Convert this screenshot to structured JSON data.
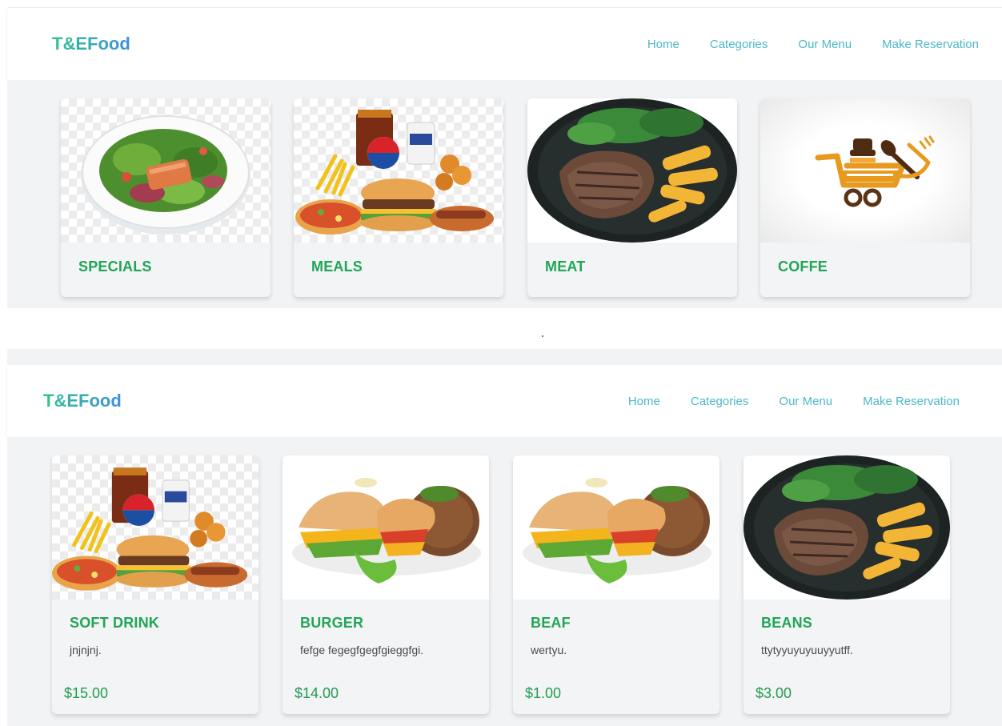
{
  "screenshots": [
    {
      "brand": "T&EFood",
      "nav": [
        "Home",
        "Categories",
        "Our Menu",
        "Make Reservation"
      ],
      "cards": [
        {
          "title": "SPECIALS",
          "image": "salmon-salad-icon"
        },
        {
          "title": "MEALS",
          "image": "fastfood-combo-icon"
        },
        {
          "title": "MEAT",
          "image": "steak-plate-icon"
        },
        {
          "title": "COFFE",
          "image": "food-cart-logo-icon"
        }
      ]
    },
    {
      "brand": "T&EFood",
      "nav": [
        "Home",
        "Categories",
        "Our Menu",
        "Make Reservation"
      ],
      "cards": [
        {
          "title": "SOFT DRINK",
          "description": "jnjnjnj.",
          "price": "$15.00",
          "image": "fastfood-combo-icon"
        },
        {
          "title": "BURGER",
          "description": "fefge fegegfgegfgieggfgi.",
          "price": "$14.00",
          "image": "sandwich-plate-icon"
        },
        {
          "title": "BEAF",
          "description": "wertyu.",
          "price": "$1.00",
          "image": "sandwich-plate-icon"
        },
        {
          "title": "BEANS",
          "description": "ttytyyuyuyuuyyutff.",
          "price": "$3.00",
          "image": "steak-plate-icon"
        }
      ]
    }
  ],
  "colors": {
    "brand_gradient_start": "#33c48a",
    "brand_gradient_end": "#3f8fe0",
    "nav_link": "#4cb8c8",
    "card_title": "#22a557",
    "price": "#229c4f",
    "band_background": "#f1f3f5"
  }
}
